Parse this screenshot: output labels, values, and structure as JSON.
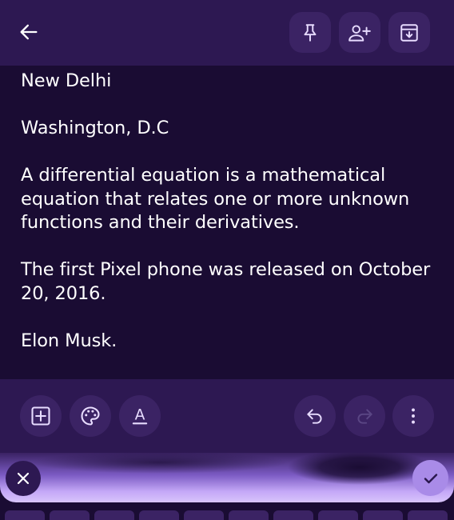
{
  "toolbar": {
    "back_icon": "arrow-left-icon",
    "pin_icon": "pin-icon",
    "collaborator_icon": "person-add-icon",
    "archive_icon": "archive-icon"
  },
  "note": {
    "paragraphs": [
      "New Delhi",
      "Washington, D.C",
      "A differential equation is a mathematical equation that relates one or more unknown functions and their derivatives.",
      "The first Pixel phone was released on October 20, 2016.",
      "Elon Musk."
    ]
  },
  "bottom_bar": {
    "add_icon": "add-box-icon",
    "palette_icon": "palette-icon",
    "format_label": "A",
    "format_icon": "text-format-icon",
    "undo_icon": "undo-icon",
    "redo_icon": "redo-icon",
    "more_icon": "more-vert-icon"
  },
  "input_strip": {
    "close_icon": "close-icon",
    "confirm_icon": "check-icon"
  },
  "colors": {
    "background": "#1a0c33",
    "bar": "#2d1852",
    "button": "#3b2364",
    "accent": "#a98be8"
  }
}
